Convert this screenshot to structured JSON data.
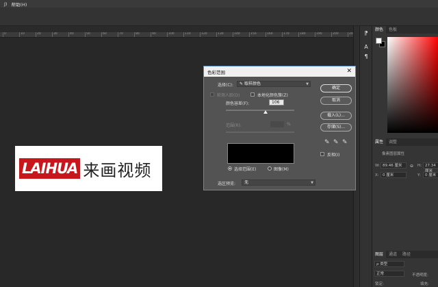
{
  "menubar": {
    "items": [
      "J)",
      "帮助(H)"
    ]
  },
  "ruler": {
    "ticks": [
      "0",
      "10",
      "20",
      "30",
      "40",
      "50",
      "60",
      "70",
      "80",
      "90",
      "100",
      "110",
      "120",
      "130",
      "140",
      "150",
      "160",
      "170",
      "180",
      "190",
      "200",
      "20"
    ]
  },
  "logo": {
    "en": "LAIHUA",
    "cn": "来画视频"
  },
  "toolstrip": {
    "icons": [
      "paragraph-styles-icon",
      "character-icon",
      "paragraph-icon"
    ]
  },
  "right_panel": {
    "color_tabs": [
      "颜色",
      "色板"
    ],
    "properties_tabs": [
      "属性",
      "调整"
    ],
    "properties_title": "像素图层属性",
    "width_label": "W:",
    "width_value": "89.46 厘米",
    "height_label": "H:",
    "height_value": "27.34 厘米",
    "x_label": "X:",
    "x_value": "0 厘米",
    "y_label": "Y:",
    "y_value": "0 厘米",
    "layers_tabs": [
      "图层",
      "通道",
      "路径"
    ],
    "kind_placeholder": "ρ 类型",
    "blend_mode": "正常",
    "opacity_label": "不透明度:",
    "lock_label": "锁定:",
    "fill_label": "填充:"
  },
  "dialog": {
    "title": "色彩范围",
    "close": "✕",
    "select_label": "选择(C):",
    "select_value": "取样颜色",
    "detect_faces": "检测人脸(D)",
    "localized_clusters": "本地化颜色簇(Z)",
    "fuzziness_label": "颜色容差(F):",
    "fuzziness_value": "106",
    "range_label": "范围(R):",
    "range_unit": "%",
    "radio_selection": "选择范围(E)",
    "radio_image": "图像(M)",
    "selection_preview_label": "选区预览:",
    "selection_preview_value": "无",
    "btn_ok": "确定",
    "btn_cancel": "取消",
    "btn_load": "载入(L)...",
    "btn_save": "存储(S)...",
    "invert": "反相(I)",
    "fuzziness_fraction": 0.58
  }
}
